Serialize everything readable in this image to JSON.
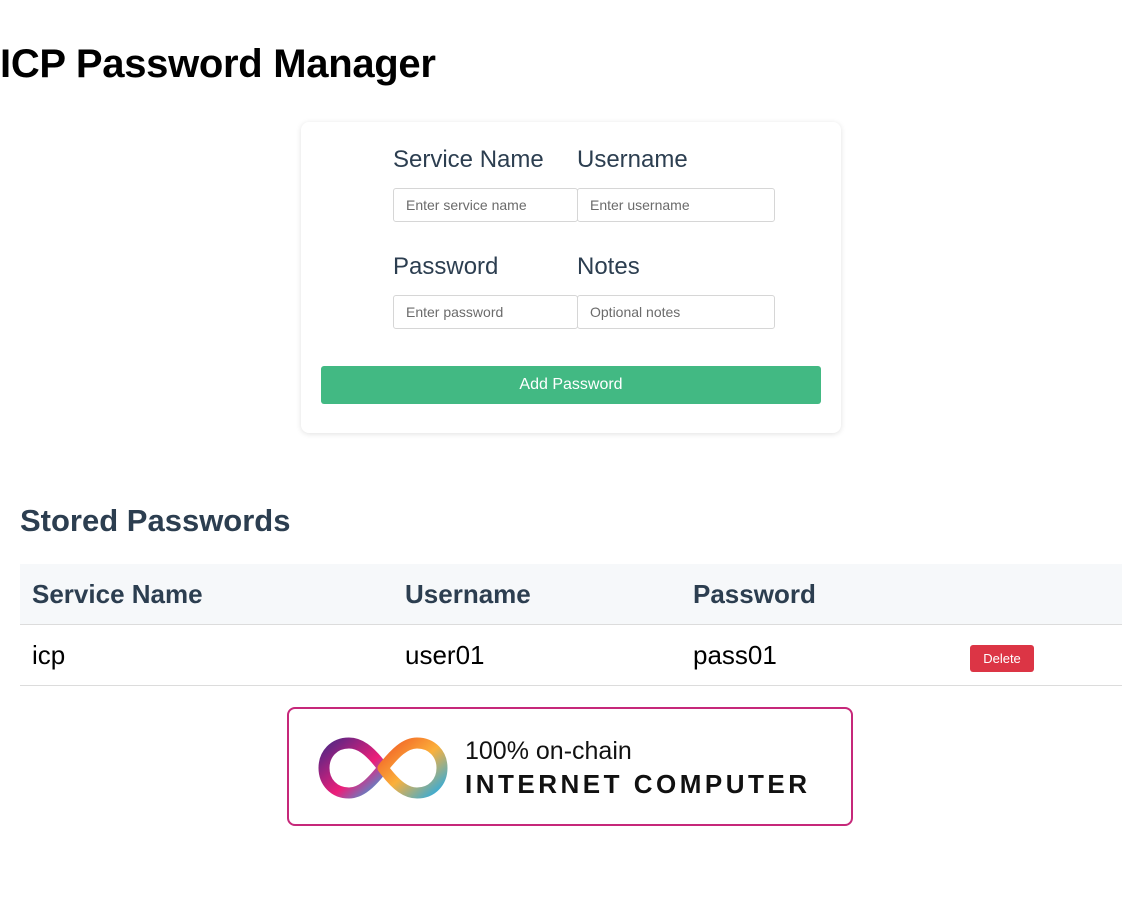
{
  "app": {
    "title": "ICP Password Manager"
  },
  "form": {
    "service": {
      "label": "Service Name",
      "placeholder": "Enter service name",
      "value": ""
    },
    "username": {
      "label": "Username",
      "placeholder": "Enter username",
      "value": ""
    },
    "password": {
      "label": "Password",
      "placeholder": "Enter password",
      "value": ""
    },
    "notes": {
      "label": "Notes",
      "placeholder": "Optional notes",
      "value": ""
    },
    "submit_label": "Add Password",
    "submit_color": "#42b983"
  },
  "stored": {
    "title": "Stored Passwords",
    "columns": [
      "Service Name",
      "Username",
      "Password",
      ""
    ],
    "rows": [
      {
        "service": "icp",
        "username": "user01",
        "password": "pass01",
        "delete_label": "Delete"
      }
    ],
    "delete_color": "#dc3545"
  },
  "badge": {
    "line1": "100% on-chain",
    "line2": "INTERNET COMPUTER",
    "logo_icon": "infinity-icon"
  }
}
